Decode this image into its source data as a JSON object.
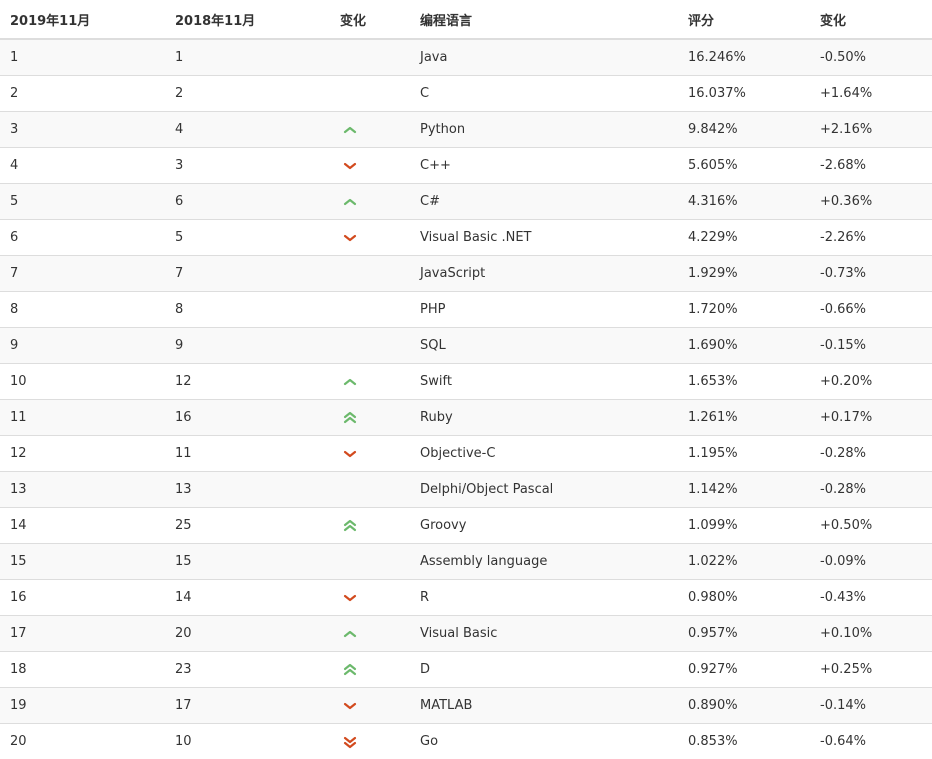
{
  "header": {
    "col_rank_2019": "2019年11月",
    "col_rank_2018": "2018年11月",
    "col_change": "变化",
    "col_language": "编程语言",
    "col_rating": "评分",
    "col_delta": "变化"
  },
  "colors": {
    "up": "#6cb96c",
    "down": "#d24a1e"
  },
  "rows": [
    {
      "rank_2019": "1",
      "rank_2018": "1",
      "trend": "none",
      "language": "Java",
      "rating": "16.246%",
      "delta": "-0.50%"
    },
    {
      "rank_2019": "2",
      "rank_2018": "2",
      "trend": "none",
      "language": "C",
      "rating": "16.037%",
      "delta": "+1.64%"
    },
    {
      "rank_2019": "3",
      "rank_2018": "4",
      "trend": "up",
      "language": "Python",
      "rating": "9.842%",
      "delta": "+2.16%"
    },
    {
      "rank_2019": "4",
      "rank_2018": "3",
      "trend": "down",
      "language": "C++",
      "rating": "5.605%",
      "delta": "-2.68%"
    },
    {
      "rank_2019": "5",
      "rank_2018": "6",
      "trend": "up",
      "language": "C#",
      "rating": "4.316%",
      "delta": "+0.36%"
    },
    {
      "rank_2019": "6",
      "rank_2018": "5",
      "trend": "down",
      "language": "Visual Basic .NET",
      "rating": "4.229%",
      "delta": "-2.26%"
    },
    {
      "rank_2019": "7",
      "rank_2018": "7",
      "trend": "none",
      "language": "JavaScript",
      "rating": "1.929%",
      "delta": "-0.73%"
    },
    {
      "rank_2019": "8",
      "rank_2018": "8",
      "trend": "none",
      "language": "PHP",
      "rating": "1.720%",
      "delta": "-0.66%"
    },
    {
      "rank_2019": "9",
      "rank_2018": "9",
      "trend": "none",
      "language": "SQL",
      "rating": "1.690%",
      "delta": "-0.15%"
    },
    {
      "rank_2019": "10",
      "rank_2018": "12",
      "trend": "up",
      "language": "Swift",
      "rating": "1.653%",
      "delta": "+0.20%"
    },
    {
      "rank_2019": "11",
      "rank_2018": "16",
      "trend": "double-up",
      "language": "Ruby",
      "rating": "1.261%",
      "delta": "+0.17%"
    },
    {
      "rank_2019": "12",
      "rank_2018": "11",
      "trend": "down",
      "language": "Objective-C",
      "rating": "1.195%",
      "delta": "-0.28%"
    },
    {
      "rank_2019": "13",
      "rank_2018": "13",
      "trend": "none",
      "language": "Delphi/Object Pascal",
      "rating": "1.142%",
      "delta": "-0.28%"
    },
    {
      "rank_2019": "14",
      "rank_2018": "25",
      "trend": "double-up",
      "language": "Groovy",
      "rating": "1.099%",
      "delta": "+0.50%"
    },
    {
      "rank_2019": "15",
      "rank_2018": "15",
      "trend": "none",
      "language": "Assembly language",
      "rating": "1.022%",
      "delta": "-0.09%"
    },
    {
      "rank_2019": "16",
      "rank_2018": "14",
      "trend": "down",
      "language": "R",
      "rating": "0.980%",
      "delta": "-0.43%"
    },
    {
      "rank_2019": "17",
      "rank_2018": "20",
      "trend": "up",
      "language": "Visual Basic",
      "rating": "0.957%",
      "delta": "+0.10%"
    },
    {
      "rank_2019": "18",
      "rank_2018": "23",
      "trend": "double-up",
      "language": "D",
      "rating": "0.927%",
      "delta": "+0.25%"
    },
    {
      "rank_2019": "19",
      "rank_2018": "17",
      "trend": "down",
      "language": "MATLAB",
      "rating": "0.890%",
      "delta": "-0.14%"
    },
    {
      "rank_2019": "20",
      "rank_2018": "10",
      "trend": "double-down",
      "language": "Go",
      "rating": "0.853%",
      "delta": "-0.64%"
    }
  ]
}
